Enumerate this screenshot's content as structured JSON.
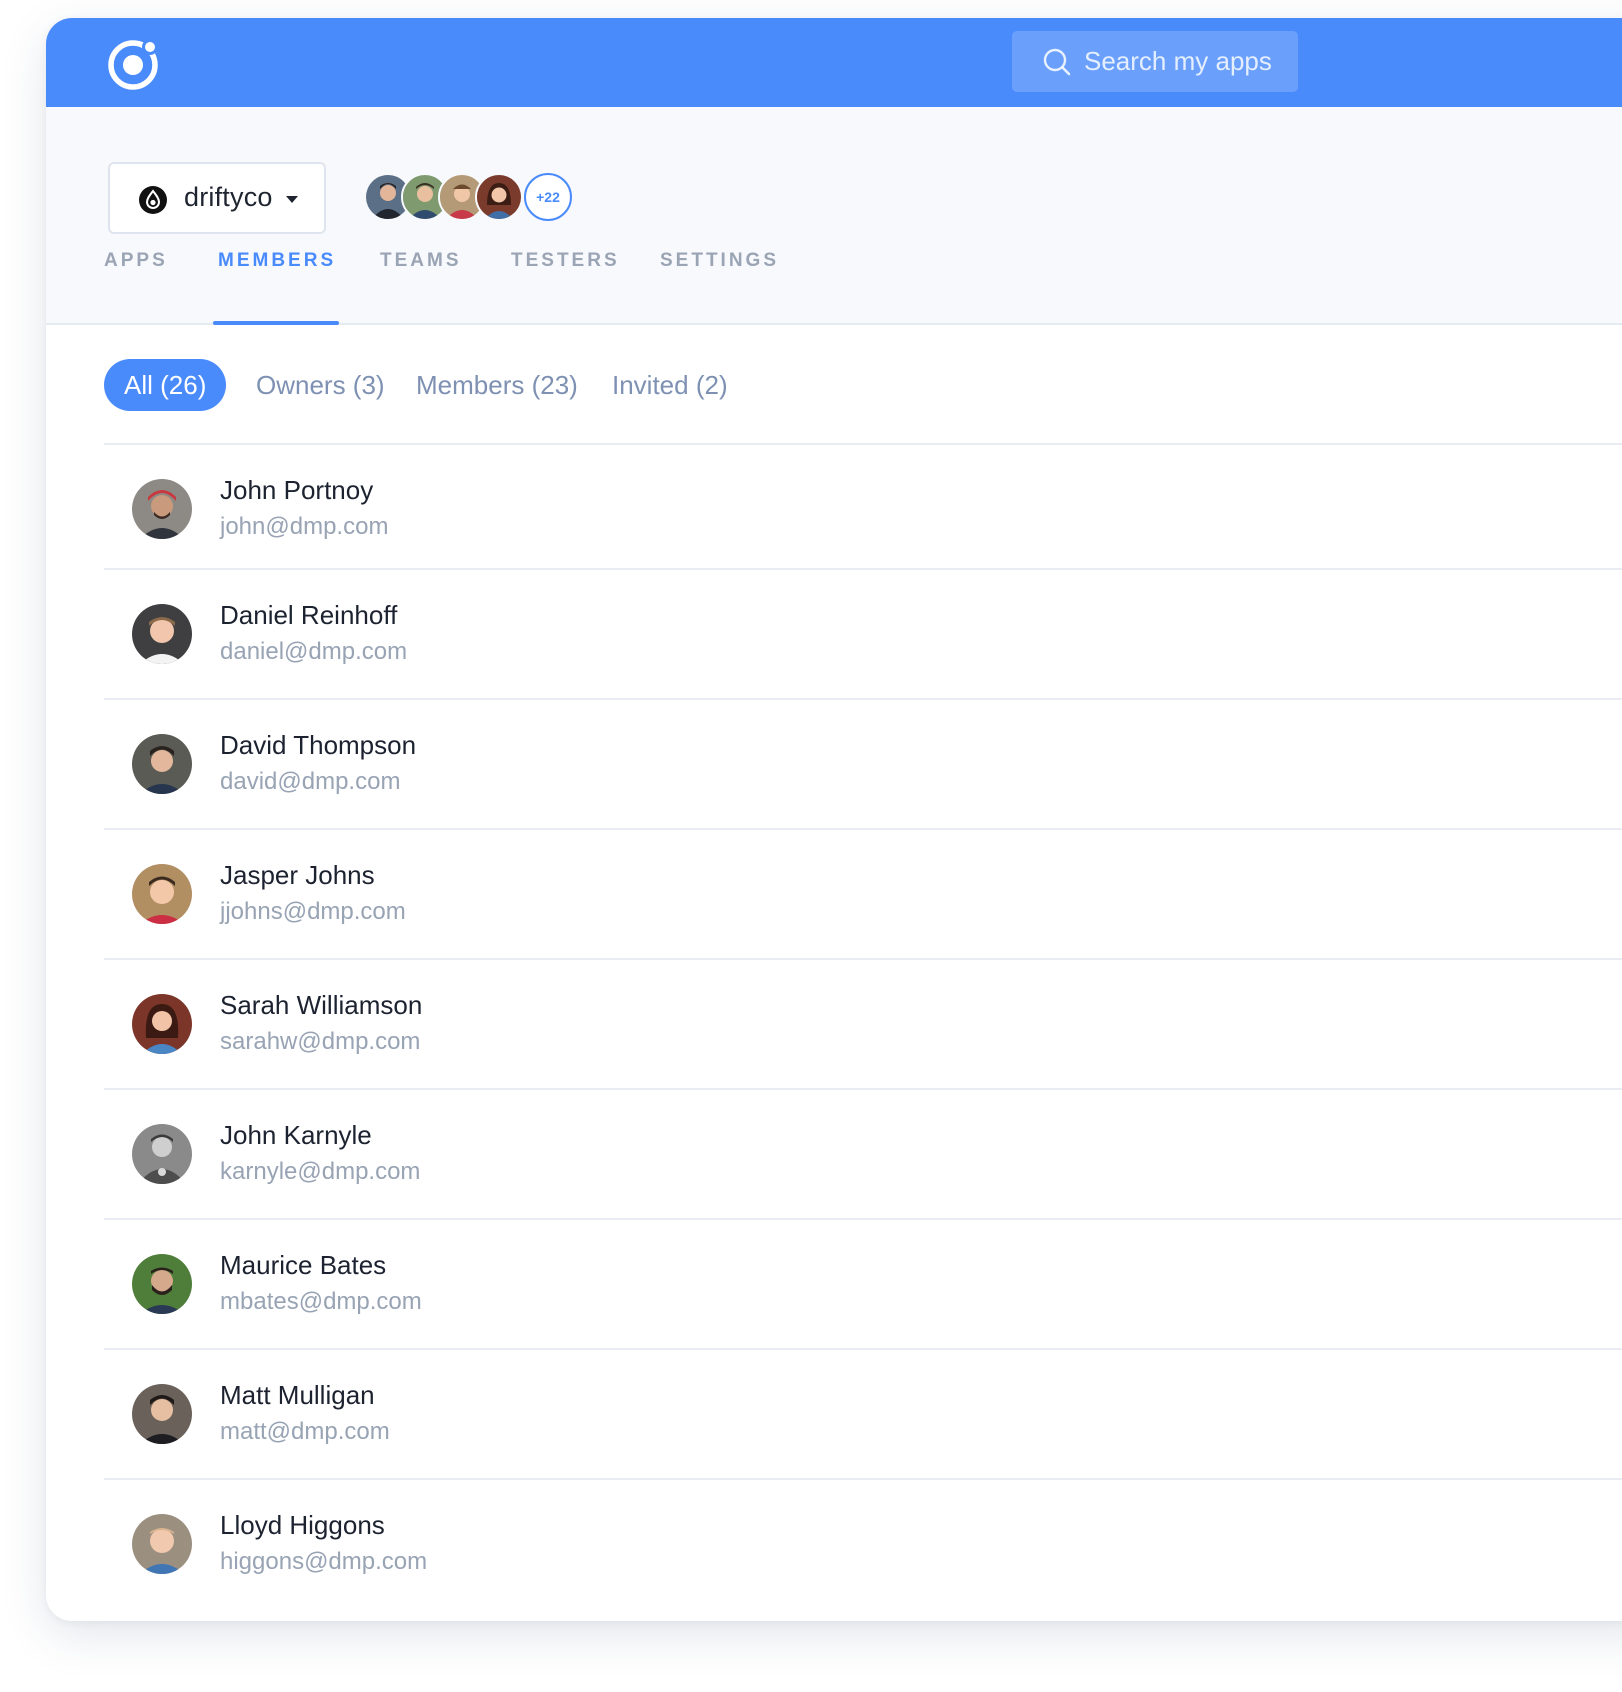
{
  "search": {
    "placeholder": "Search my apps"
  },
  "org": {
    "name": "driftyco"
  },
  "team_stack": {
    "more_label": "+22"
  },
  "tabs": [
    {
      "label": "APPS",
      "active": false
    },
    {
      "label": "MEMBERS",
      "active": true
    },
    {
      "label": "TEAMS",
      "active": false
    },
    {
      "label": "TESTERS",
      "active": false
    },
    {
      "label": "SETTINGS",
      "active": false
    }
  ],
  "filters": [
    {
      "label": "All (26)",
      "active": true
    },
    {
      "label": "Owners (3)",
      "active": false
    },
    {
      "label": "Members (23)",
      "active": false
    },
    {
      "label": "Invited (2)",
      "active": false
    }
  ],
  "members": [
    {
      "name": "John Portnoy",
      "email": "john@dmp.com"
    },
    {
      "name": "Daniel Reinhoff",
      "email": "daniel@dmp.com"
    },
    {
      "name": "David Thompson",
      "email": "david@dmp.com"
    },
    {
      "name": "Jasper Johns",
      "email": "jjohns@dmp.com"
    },
    {
      "name": "Sarah Williamson",
      "email": "sarahw@dmp.com"
    },
    {
      "name": "John Karnyle",
      "email": "karnyle@dmp.com"
    },
    {
      "name": "Maurice Bates",
      "email": "mbates@dmp.com"
    },
    {
      "name": "Matt Mulligan",
      "email": "matt@dmp.com"
    },
    {
      "name": "Lloyd Higgons",
      "email": "higgons@dmp.com"
    }
  ],
  "colors": {
    "accent": "#4a8bfc",
    "header_bg": "#f7f9fc",
    "muted_text": "#98a3b4"
  }
}
